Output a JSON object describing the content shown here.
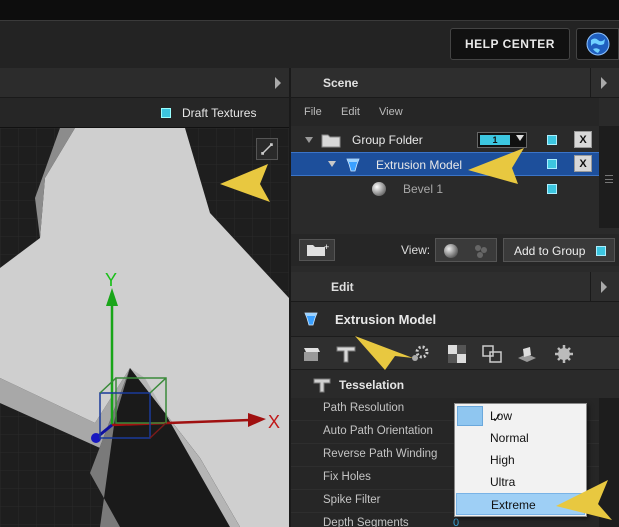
{
  "topbar": {
    "help_center_label": "HELP CENTER"
  },
  "viewport": {
    "draft_textures_label": "Draft Textures",
    "axis_y": "Y",
    "axis_x": "X"
  },
  "scene": {
    "title": "Scene",
    "menu": [
      "File",
      "Edit",
      "View"
    ],
    "tree": [
      {
        "label": "Group Folder",
        "level": "1"
      },
      {
        "label": "Extrusion Model"
      },
      {
        "label": "Bevel 1"
      }
    ],
    "view_label": "View:",
    "add_to_group_label": "Add to Group"
  },
  "edit": {
    "title": "Edit",
    "object_title": "Extrusion Model",
    "section_title": "Tesselation",
    "properties": [
      {
        "label": "Path Resolution",
        "value": ""
      },
      {
        "label": "Auto Path Orientation",
        "value": ""
      },
      {
        "label": "Reverse Path Winding",
        "value": ""
      },
      {
        "label": "Fix Holes",
        "value": ""
      },
      {
        "label": "Spike Filter",
        "value": ""
      },
      {
        "label": "Depth Segments",
        "value": "0"
      }
    ]
  },
  "resolution_dropdown": {
    "options": [
      "Low",
      "Normal",
      "High",
      "Ultra",
      "Extreme"
    ],
    "selected": "Low",
    "highlighted": "Extreme"
  },
  "colors": {
    "accent": "#3cc6e0",
    "selection": "#1d4f9b",
    "callout": "#e8c840"
  }
}
